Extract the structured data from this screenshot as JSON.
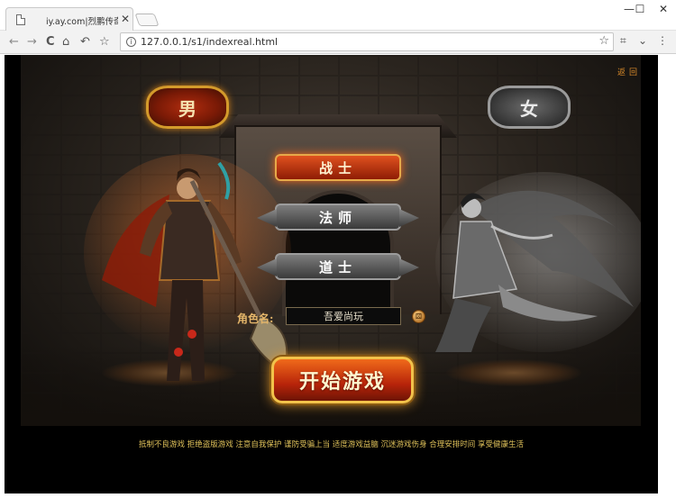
{
  "browser": {
    "tab_title": "iy.ay.com|烈鹏传奇之",
    "tab_close": "✕",
    "url": "127.0.0.1/s1/indexreal.html",
    "window_controls": {
      "minimize": "—",
      "maximize": "☐",
      "close": "✕"
    },
    "nav_icons": {
      "back": "←",
      "forward": "→",
      "reload": "C",
      "home": "⌂",
      "undo": "↶",
      "bookmark": "☆"
    },
    "toolbar_icons": {
      "star": "☆",
      "crop": "⌗",
      "extensions": "⌄",
      "menu": "⋮"
    },
    "info_icon": "i"
  },
  "game": {
    "return_link": "返回",
    "gender": {
      "male": "男",
      "female": "女"
    },
    "classes": {
      "warrior": "战士",
      "mage": "法师",
      "taoist": "道士"
    },
    "selected_class": "战士",
    "name_label": "角色名:",
    "name_value": "吾爱尚玩",
    "random_icon": "⚄",
    "start_button": "开始游戏",
    "footer_notice": "抵制不良游戏 拒绝盗版游戏 注意自我保护 谨防受骗上当 适度游戏益脑 沉迷游戏伤身 合理安排时间 享受健康生活"
  },
  "colors": {
    "accent_gold": "#e0c25a",
    "return_link": "#d98a2a",
    "selected_class_bg": "#e0521f",
    "page_bg": "#000000"
  }
}
